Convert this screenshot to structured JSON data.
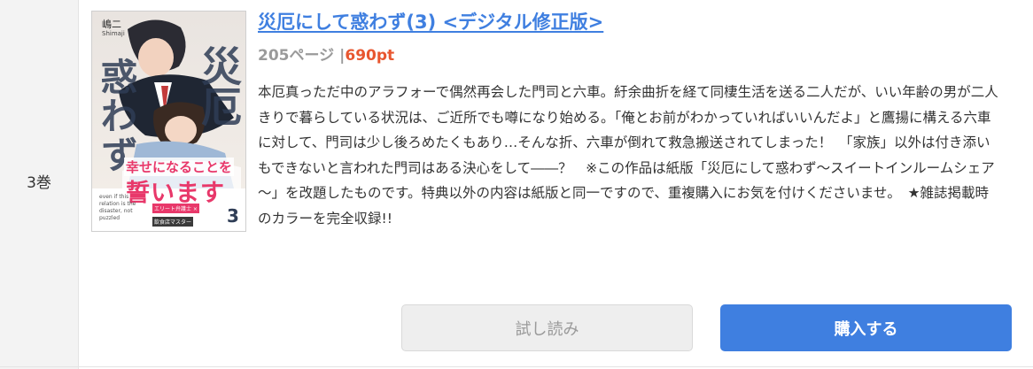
{
  "volume": {
    "label": "3巻"
  },
  "cover": {
    "author": "嶋二",
    "author_en": "Shimaji",
    "title_part1": "惑わず",
    "title_part2": "災厄",
    "tagline_small": "幸せになることを",
    "tagline_large": "誓います",
    "english_blurb": "even if this relation is the disaster, not puzzled",
    "sub_label_1": "エリート弁護士 ×",
    "sub_label_2": "飲食店マスター",
    "volume_number": "3"
  },
  "title": "災厄にして惑わず(3) <デジタル修正版>",
  "meta": {
    "pages": "205ページ",
    "separator": "|",
    "price": "690pt"
  },
  "description": "本厄真っただ中のアラフォーで偶然再会した門司と六車。紆余曲折を経て同棲生活を送る二人だが、いい年齢の男が二人きりで暮らしている状況は、ご近所でも噂になり始める。「俺とお前がわかっていればいいんだよ」と鷹揚に構える六車に対して、門司は少し後ろめたくもあり…そんな折、六車が倒れて救急搬送されてしまった！　「家族」以外は付き添いもできないと言われた門司はある決心をして――？　※この作品は紙版「災厄にして惑わず～スイートインルームシェア～」を改題したものです。特典以外の内容は紙版と同一ですので、重複購入にお気を付けくださいませ。　★雑誌掲載時のカラーを完全収録!!",
  "buttons": {
    "trial": "試し読み",
    "buy": "購入する"
  },
  "colors": {
    "accent": "#3f7fe0",
    "price": "#e8562f",
    "muted": "#9a9a9a",
    "sidebar_bg": "#f3f3f3"
  }
}
